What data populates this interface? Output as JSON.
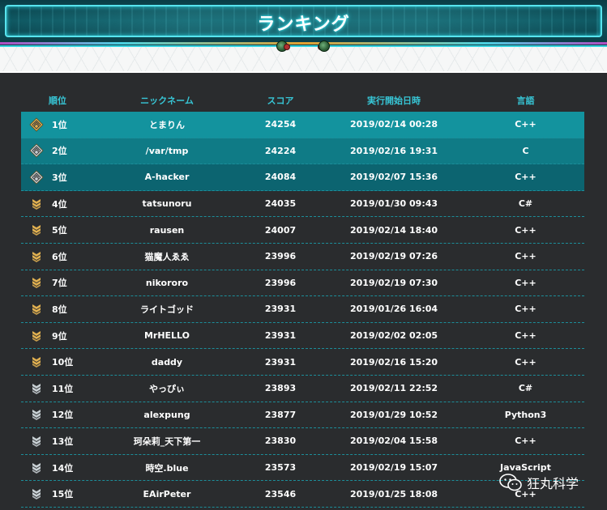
{
  "header": {
    "title": "ランキング"
  },
  "columns": {
    "rank": "順位",
    "nickname": "ニックネーム",
    "score": "スコア",
    "start_time": "実行開始日時",
    "language": "言語"
  },
  "rows": [
    {
      "rank": "1位",
      "nickname": "とまりん",
      "score": "24254",
      "start_time": "2019/02/14 00:28",
      "language": "C++",
      "badge": "gold-diamond-badge-icon"
    },
    {
      "rank": "2位",
      "nickname": "/var/tmp",
      "score": "24224",
      "start_time": "2019/02/16 19:31",
      "language": "C",
      "badge": "silver-diamond-badge-icon"
    },
    {
      "rank": "3位",
      "nickname": "A-hacker",
      "score": "24084",
      "start_time": "2019/02/07 15:36",
      "language": "C++",
      "badge": "silver-diamond-badge-icon"
    },
    {
      "rank": "4位",
      "nickname": "tatsunoru",
      "score": "24035",
      "start_time": "2019/01/30 09:43",
      "language": "C#",
      "badge": "gold-chevron-badge-icon"
    },
    {
      "rank": "5位",
      "nickname": "rausen",
      "score": "24007",
      "start_time": "2019/02/14 18:40",
      "language": "C++",
      "badge": "gold-chevron-badge-icon"
    },
    {
      "rank": "6位",
      "nickname": "猫魔人ゑゑ",
      "score": "23996",
      "start_time": "2019/02/19 07:26",
      "language": "C++",
      "badge": "gold-chevron-badge-icon"
    },
    {
      "rank": "7位",
      "nickname": "nikororo",
      "score": "23996",
      "start_time": "2019/02/19 07:30",
      "language": "C++",
      "badge": "gold-chevron-badge-icon"
    },
    {
      "rank": "8位",
      "nickname": "ライトゴッド",
      "score": "23931",
      "start_time": "2019/01/26 16:04",
      "language": "C++",
      "badge": "gold-chevron-badge-icon"
    },
    {
      "rank": "9位",
      "nickname": "MrHELLO",
      "score": "23931",
      "start_time": "2019/02/02 02:05",
      "language": "C++",
      "badge": "gold-chevron-badge-icon"
    },
    {
      "rank": "10位",
      "nickname": "daddy",
      "score": "23931",
      "start_time": "2019/02/16 15:20",
      "language": "C++",
      "badge": "gold-chevron-badge-icon"
    },
    {
      "rank": "11位",
      "nickname": "やっぴぃ",
      "score": "23893",
      "start_time": "2019/02/11 22:52",
      "language": "C#",
      "badge": "silver-chevron-badge-icon"
    },
    {
      "rank": "12位",
      "nickname": "alexpung",
      "score": "23877",
      "start_time": "2019/01/29 10:52",
      "language": "Python3",
      "badge": "silver-chevron-badge-icon"
    },
    {
      "rank": "13位",
      "nickname": "珂朵莉_天下第一",
      "score": "23830",
      "start_time": "2019/02/04 15:58",
      "language": "C++",
      "badge": "silver-chevron-badge-icon"
    },
    {
      "rank": "14位",
      "nickname": "時空.blue",
      "score": "23573",
      "start_time": "2019/02/19 15:07",
      "language": "JavaScript",
      "badge": "silver-chevron-badge-icon"
    },
    {
      "rank": "15位",
      "nickname": "EAirPeter",
      "score": "23546",
      "start_time": "2019/01/25 18:08",
      "language": "C++",
      "badge": "silver-chevron-badge-icon"
    }
  ],
  "watermark": {
    "text": "狂丸科学",
    "icon": "wechat-icon"
  },
  "colors": {
    "background": "#2a2c2e",
    "header_text": "#37c6d6",
    "row_top1": "#13939e",
    "row_top2": "#0f7b86",
    "row_top3": "#0c6470",
    "divider": "#1c8e9a",
    "gold": "#e0b050",
    "silver": "#c8d0d4"
  }
}
